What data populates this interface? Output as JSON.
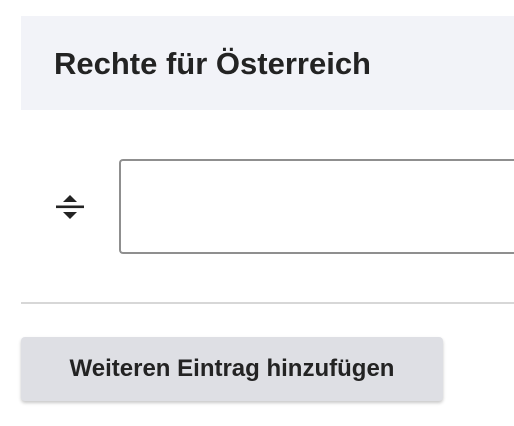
{
  "section": {
    "title": "Rechte für Österreich"
  },
  "row": {
    "drag_icon": "drag-handle-icon",
    "input_value": "",
    "input_placeholder": ""
  },
  "actions": {
    "add_label": "Weiteren Eintrag hinzufügen"
  },
  "colors": {
    "header_bg": "#f2f3f8",
    "button_bg": "#dedfe4",
    "text": "#232323",
    "input_border": "#8f8f8f",
    "divider": "#d7d7d7"
  }
}
